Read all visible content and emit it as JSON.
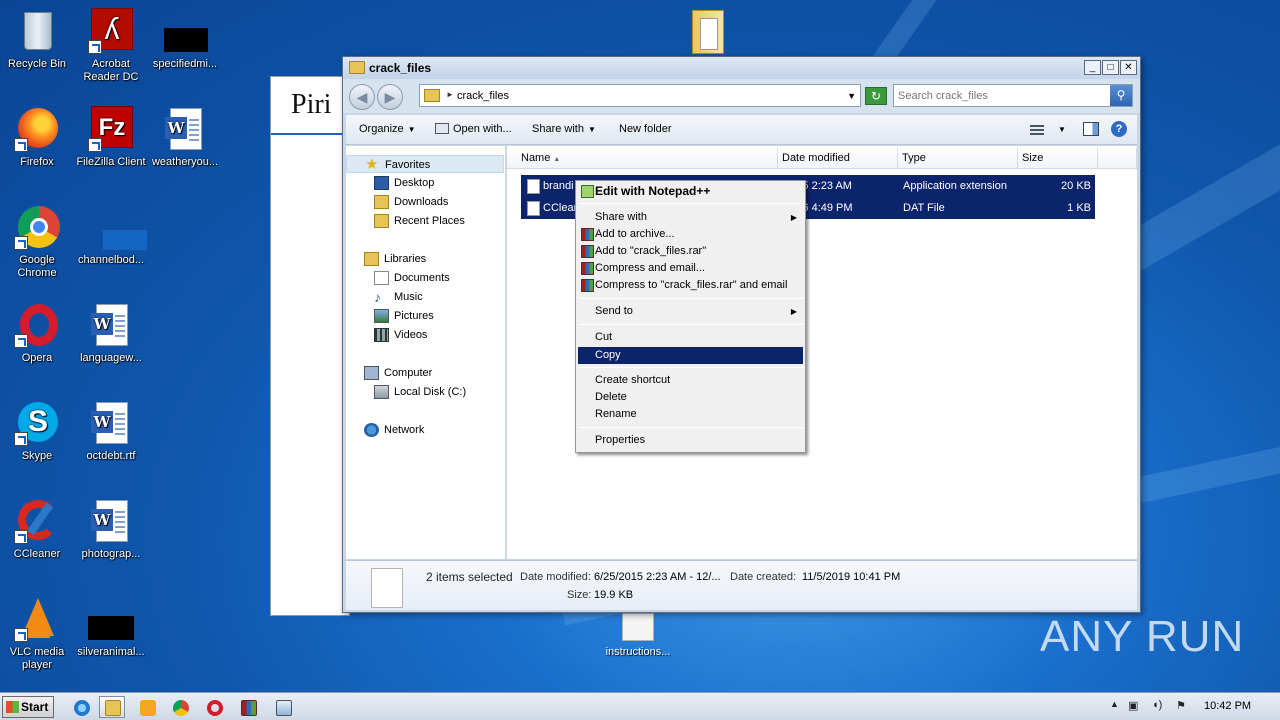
{
  "desktop": {
    "icons": [
      {
        "label": "Recycle Bin"
      },
      {
        "label": "Acrobat Reader DC"
      },
      {
        "label": "specifiedmi..."
      },
      {
        "label": "Firefox"
      },
      {
        "label": "FileZilla Client"
      },
      {
        "label": "weatheryou..."
      },
      {
        "label": "Google Chrome"
      },
      {
        "label": "channelbod..."
      },
      {
        "label": "Opera"
      },
      {
        "label": "languagew..."
      },
      {
        "label": "Skype"
      },
      {
        "label": "octdebt.rtf"
      },
      {
        "label": "CCleaner"
      },
      {
        "label": "photograp..."
      },
      {
        "label": "VLC media player"
      },
      {
        "label": "silveranimal..."
      }
    ],
    "instructions_label": "instructions...",
    "watermark": "ANY RUN",
    "background_window_title": "Piri"
  },
  "explorer": {
    "title": "crack_files",
    "address": "crack_files",
    "search_placeholder": "Search crack_files",
    "toolbar": {
      "organize": "Organize",
      "open_with": "Open with...",
      "share_with": "Share with",
      "new_folder": "New folder"
    },
    "nav": {
      "favorites": "Favorites",
      "desktop": "Desktop",
      "downloads": "Downloads",
      "recent_places": "Recent Places",
      "libraries": "Libraries",
      "documents": "Documents",
      "music": "Music",
      "pictures": "Pictures",
      "videos": "Videos",
      "computer": "Computer",
      "local_disk": "Local Disk (C:)",
      "network": "Network"
    },
    "columns": {
      "name": "Name",
      "date_modified": "Date modified",
      "type": "Type",
      "size": "Size"
    },
    "files": [
      {
        "name": "brandi",
        "date": "/2015 2:23 AM",
        "type": "Application extension",
        "size": "20 KB"
      },
      {
        "name": "CClean",
        "date": "/2016 4:49 PM",
        "type": "DAT File",
        "size": "1 KB"
      }
    ],
    "details": {
      "selected": "2 items selected",
      "date_modified_label": "Date modified:",
      "date_modified_value": "6/25/2015 2:23 AM - 12/...",
      "date_created_label": "Date created:",
      "date_created_value": "11/5/2019 10:41 PM",
      "size_label": "Size:",
      "size_value": "19.9 KB"
    }
  },
  "context_menu": {
    "edit_notepad": "Edit with Notepad++",
    "share_with": "Share with",
    "add_archive": "Add to archive...",
    "add_rar": "Add to \"crack_files.rar\"",
    "compress_email": "Compress and email...",
    "compress_rar_email": "Compress to \"crack_files.rar\" and email",
    "send_to": "Send to",
    "cut": "Cut",
    "copy": "Copy",
    "create_shortcut": "Create shortcut",
    "delete": "Delete",
    "rename": "Rename",
    "properties": "Properties"
  },
  "taskbar": {
    "start": "Start",
    "clock": "10:42 PM"
  }
}
